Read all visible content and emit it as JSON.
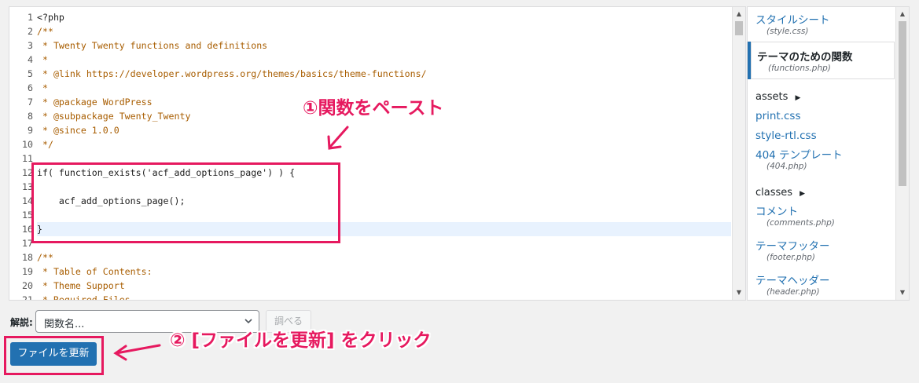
{
  "editor": {
    "lines": [
      {
        "n": "1",
        "text": "<?php",
        "type": "code"
      },
      {
        "n": "2",
        "text": "/**",
        "type": "comment"
      },
      {
        "n": "3",
        "text": " * Twenty Twenty functions and definitions",
        "type": "comment"
      },
      {
        "n": "4",
        "text": " *",
        "type": "comment"
      },
      {
        "n": "5",
        "text": " * @link https://developer.wordpress.org/themes/basics/theme-functions/",
        "type": "comment"
      },
      {
        "n": "6",
        "text": " *",
        "type": "comment"
      },
      {
        "n": "7",
        "text": " * @package WordPress",
        "type": "comment"
      },
      {
        "n": "8",
        "text": " * @subpackage Twenty_Twenty",
        "type": "comment"
      },
      {
        "n": "9",
        "text": " * @since 1.0.0",
        "type": "comment"
      },
      {
        "n": "10",
        "text": " */",
        "type": "comment"
      },
      {
        "n": "11",
        "text": "",
        "type": "code"
      },
      {
        "n": "12",
        "text": "if( function_exists('acf_add_options_page') ) {",
        "type": "code"
      },
      {
        "n": "13",
        "text": "",
        "type": "code"
      },
      {
        "n": "14",
        "text": "    acf_add_options_page();",
        "type": "code"
      },
      {
        "n": "15",
        "text": "",
        "type": "code"
      },
      {
        "n": "16",
        "text": "}",
        "type": "code"
      },
      {
        "n": "17",
        "text": "",
        "type": "code"
      },
      {
        "n": "18",
        "text": "/**",
        "type": "comment"
      },
      {
        "n": "19",
        "text": " * Table of Contents:",
        "type": "comment"
      },
      {
        "n": "20",
        "text": " * Theme Support",
        "type": "comment"
      },
      {
        "n": "21",
        "text": " * Required Files",
        "type": "comment"
      }
    ],
    "highlighted_line": "16"
  },
  "sidebar": {
    "items": [
      {
        "label": "スタイルシート",
        "file": "(style.css)",
        "kind": "file"
      },
      {
        "label": "テーマのための関数",
        "file": "(functions.php)",
        "kind": "active"
      },
      {
        "label": "assets",
        "kind": "folder"
      },
      {
        "label": "print.css",
        "kind": "plain"
      },
      {
        "label": "style-rtl.css",
        "kind": "plain"
      },
      {
        "label": "404 テンプレート",
        "file": "(404.php)",
        "kind": "file"
      },
      {
        "label": "classes",
        "kind": "folder"
      },
      {
        "label": "コメント",
        "file": "(comments.php)",
        "kind": "file"
      },
      {
        "label": "テーマフッター",
        "file": "(footer.php)",
        "kind": "file"
      },
      {
        "label": "テーマヘッダー",
        "file": "(header.php)",
        "kind": "file"
      }
    ]
  },
  "documentation": {
    "label": "解説:",
    "select_value": "関数名...",
    "lookup_button": "調べる"
  },
  "update_button": "ファイルを更新",
  "annotations": {
    "step1": "①関数をペースト",
    "step2": "② [ファイルを更新] をクリック"
  },
  "colors": {
    "accent": "#2271b1",
    "annotation": "#e6195f",
    "comment": "#a85d00"
  }
}
